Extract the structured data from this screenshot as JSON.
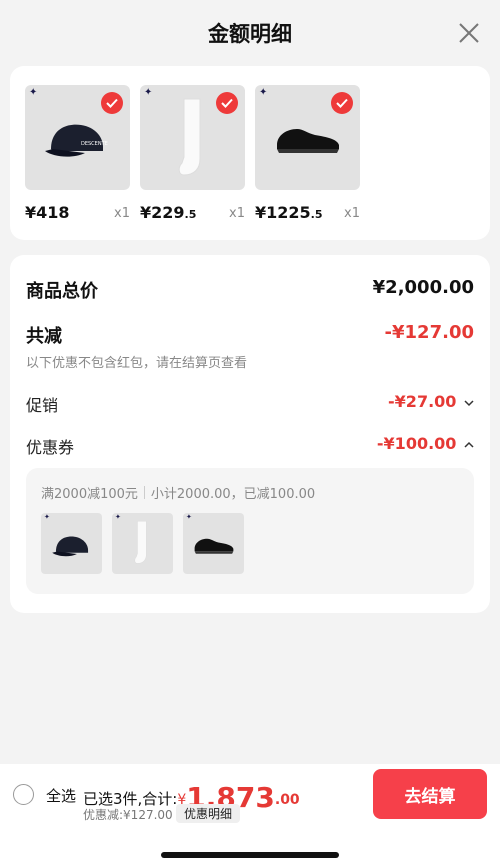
{
  "header": {
    "title": "金额明细"
  },
  "products": [
    {
      "icon": "baseball-cap-icon",
      "price": "¥418",
      "price_dec": "",
      "qty": "x1"
    },
    {
      "icon": "sock-icon",
      "price": "¥229",
      "price_dec": ".5",
      "qty": "x1"
    },
    {
      "icon": "sneaker-icon",
      "price": "¥1225",
      "price_dec": ".5",
      "qty": "x1"
    }
  ],
  "summary": {
    "total_label": "商品总价",
    "total_value": "¥2,000.00",
    "reduce_label": "共减",
    "reduce_value": "-¥127.00",
    "note": "以下优惠不包含红包，请在结算页查看",
    "promo_label": "促销",
    "promo_value": "-¥27.00",
    "coupon_label": "优惠券",
    "coupon_value": "-¥100.00",
    "coupon_rule": "满2000减100元",
    "coupon_subtotal": "小计2000.00，已减100.00"
  },
  "bottom": {
    "select_all": "全选",
    "selected_text": "已选3件,合计:",
    "currency": "¥",
    "total_int": "1,873",
    "total_dec": ".00",
    "discount": "优惠减:¥127.00",
    "detail_button": "优惠明细",
    "checkout_button": "去结算"
  },
  "colors": {
    "accent": "#e53935",
    "checkout": "#f6404a"
  }
}
